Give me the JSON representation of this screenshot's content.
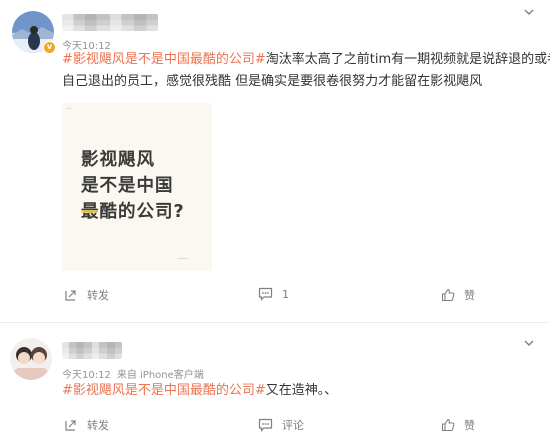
{
  "posts": [
    {
      "timestamp": "今天10:12",
      "topic": "#影视飓风是不是中国最酷的公司#",
      "text_line1_rest": "淘汰率太高了之前tim有一期视频就是说辞退的或者是",
      "text_line2": "自己退出的员工，感觉很残酷 但是确实是要很卷很努力才能留在影视飓风",
      "card": {
        "line1": "影视飓风",
        "line2": "是不是中国",
        "line3": "最酷的公司?"
      },
      "actions": {
        "repost_label": "转发",
        "comment_count": "1",
        "like_label": "赞"
      }
    },
    {
      "timestamp": "今天10:12",
      "source": "来自 iPhone客户端",
      "topic": "#影视飓风是不是中国最酷的公司#",
      "text_rest": "又在造神。、",
      "actions": {
        "repost_label": "转发",
        "comment_label": "评论",
        "like_label": "赞"
      }
    }
  ],
  "colors": {
    "topic": "#eb7350",
    "text": "#333333",
    "meta": "#939393",
    "badge": "#f6a623"
  },
  "icons": [
    "more-chevron-icon",
    "repost-icon",
    "comment-icon",
    "like-icon",
    "verified-badge-icon"
  ]
}
